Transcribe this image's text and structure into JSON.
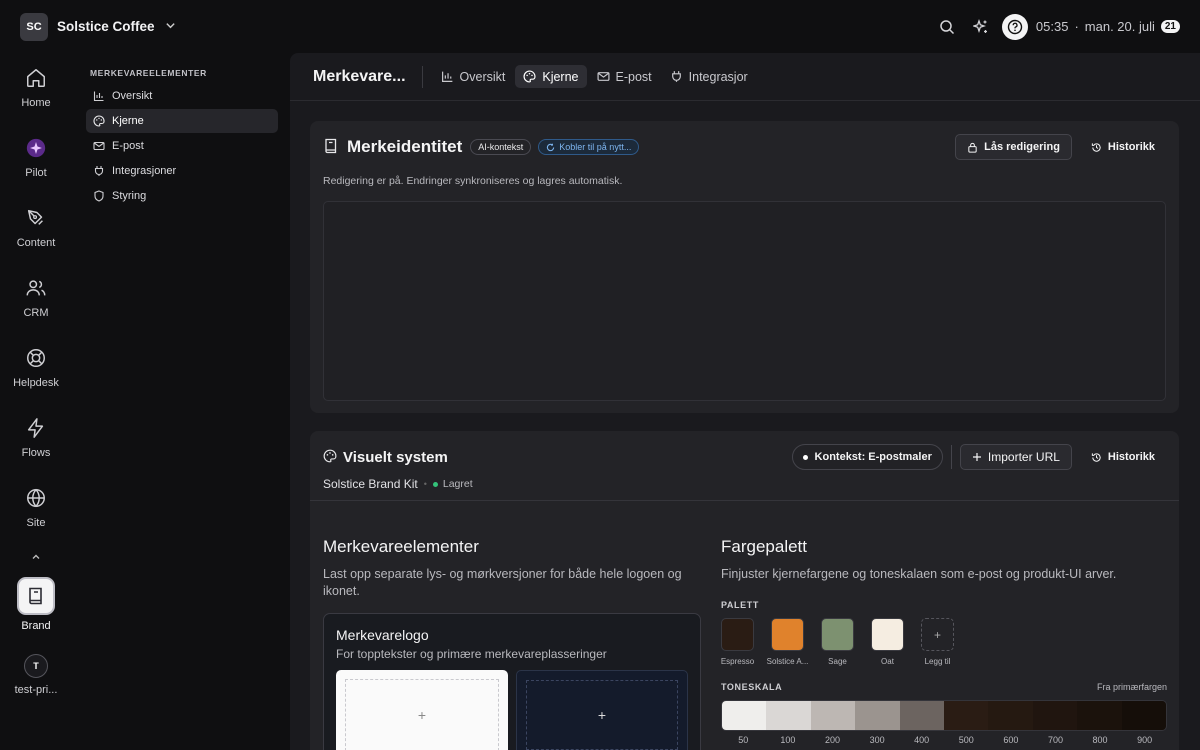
{
  "workspace": {
    "initials": "SC",
    "name": "Solstice Coffee"
  },
  "topbar": {
    "time": "05:35",
    "separator": "·",
    "date": "man. 20. juli",
    "day_badge": "21"
  },
  "rail": {
    "items": [
      {
        "label": "Home",
        "icon": "home-icon"
      },
      {
        "label": "Pilot",
        "icon": "pilot-icon"
      },
      {
        "label": "Content",
        "icon": "pen-icon"
      },
      {
        "label": "CRM",
        "icon": "users-icon"
      },
      {
        "label": "Helpdesk",
        "icon": "lifebuoy-icon"
      },
      {
        "label": "Flows",
        "icon": "bolt-icon"
      },
      {
        "label": "Site",
        "icon": "globe-icon"
      }
    ],
    "brand_label": "Brand",
    "user_initial": "T",
    "user_label": "test-pri..."
  },
  "subnav": {
    "title": "MERKEVAREELEMENTER",
    "items": [
      {
        "label": "Oversikt",
        "icon": "bar-chart-icon"
      },
      {
        "label": "Kjerne",
        "icon": "palette-icon",
        "active": true
      },
      {
        "label": "E-post",
        "icon": "mail-icon"
      },
      {
        "label": "Integrasjoner",
        "icon": "plug-icon"
      },
      {
        "label": "Styring",
        "icon": "shield-icon"
      }
    ]
  },
  "tabs": {
    "crumb": "Merkevare...",
    "items": [
      {
        "label": "Oversikt",
        "icon": "bar-chart-icon"
      },
      {
        "label": "Kjerne",
        "icon": "palette-icon",
        "active": true
      },
      {
        "label": "E-post",
        "icon": "mail-icon"
      },
      {
        "label": "Integrasjor",
        "icon": "plug-icon"
      }
    ]
  },
  "identity": {
    "title": "Merkeidentitet",
    "ai_pill": "AI-kontekst",
    "sync_pill": "Kobler til på nytt...",
    "lock_button": "Lås redigering",
    "history_button": "Historikk",
    "note": "Redigering er på. Endringer synkroniseres og lagres automatisk."
  },
  "visual": {
    "title": "Visuelt system",
    "kit_name": "Solstice Brand Kit",
    "kit_sep": "•",
    "saved": "Lagret",
    "context_button": "Kontekst: E-postmaler",
    "import_button": "Importer URL",
    "history_button": "Historikk"
  },
  "elements": {
    "title": "Merkevareelementer",
    "desc": "Last opp separate lys- og mørkversjoner for både hele logoen og ikonet.",
    "logo_title": "Merkevarelogo",
    "logo_sub": "For topptekster og primære merkevareplasseringer",
    "plus": "+"
  },
  "palette": {
    "title": "Fargepalett",
    "desc": "Finjuster kjernefargene og toneskalaen som e-post og produkt-UI arver.",
    "palette_label": "PALETT",
    "swatches": [
      {
        "name": "Espresso",
        "color": "#2a1c14"
      },
      {
        "name": "Solstice A...",
        "color": "#e0822c"
      },
      {
        "name": "Sage",
        "color": "#7d9170"
      },
      {
        "name": "Oat",
        "color": "#f5ede1"
      }
    ],
    "add_label": "Legg til",
    "add_symbol": "+",
    "tone_label": "TONESKALA",
    "tone_hint": "Fra primærfargen",
    "tones": [
      {
        "step": "50",
        "color": "#efeeec"
      },
      {
        "step": "100",
        "color": "#dad7d5"
      },
      {
        "step": "200",
        "color": "#bdb7b3"
      },
      {
        "step": "300",
        "color": "#9b948f"
      },
      {
        "step": "400",
        "color": "#6c6460"
      },
      {
        "step": "500",
        "color": "#2a1c14"
      },
      {
        "step": "600",
        "color": "#251911"
      },
      {
        "step": "700",
        "color": "#20150f"
      },
      {
        "step": "800",
        "color": "#1b120c"
      },
      {
        "step": "900",
        "color": "#150e09"
      }
    ]
  }
}
